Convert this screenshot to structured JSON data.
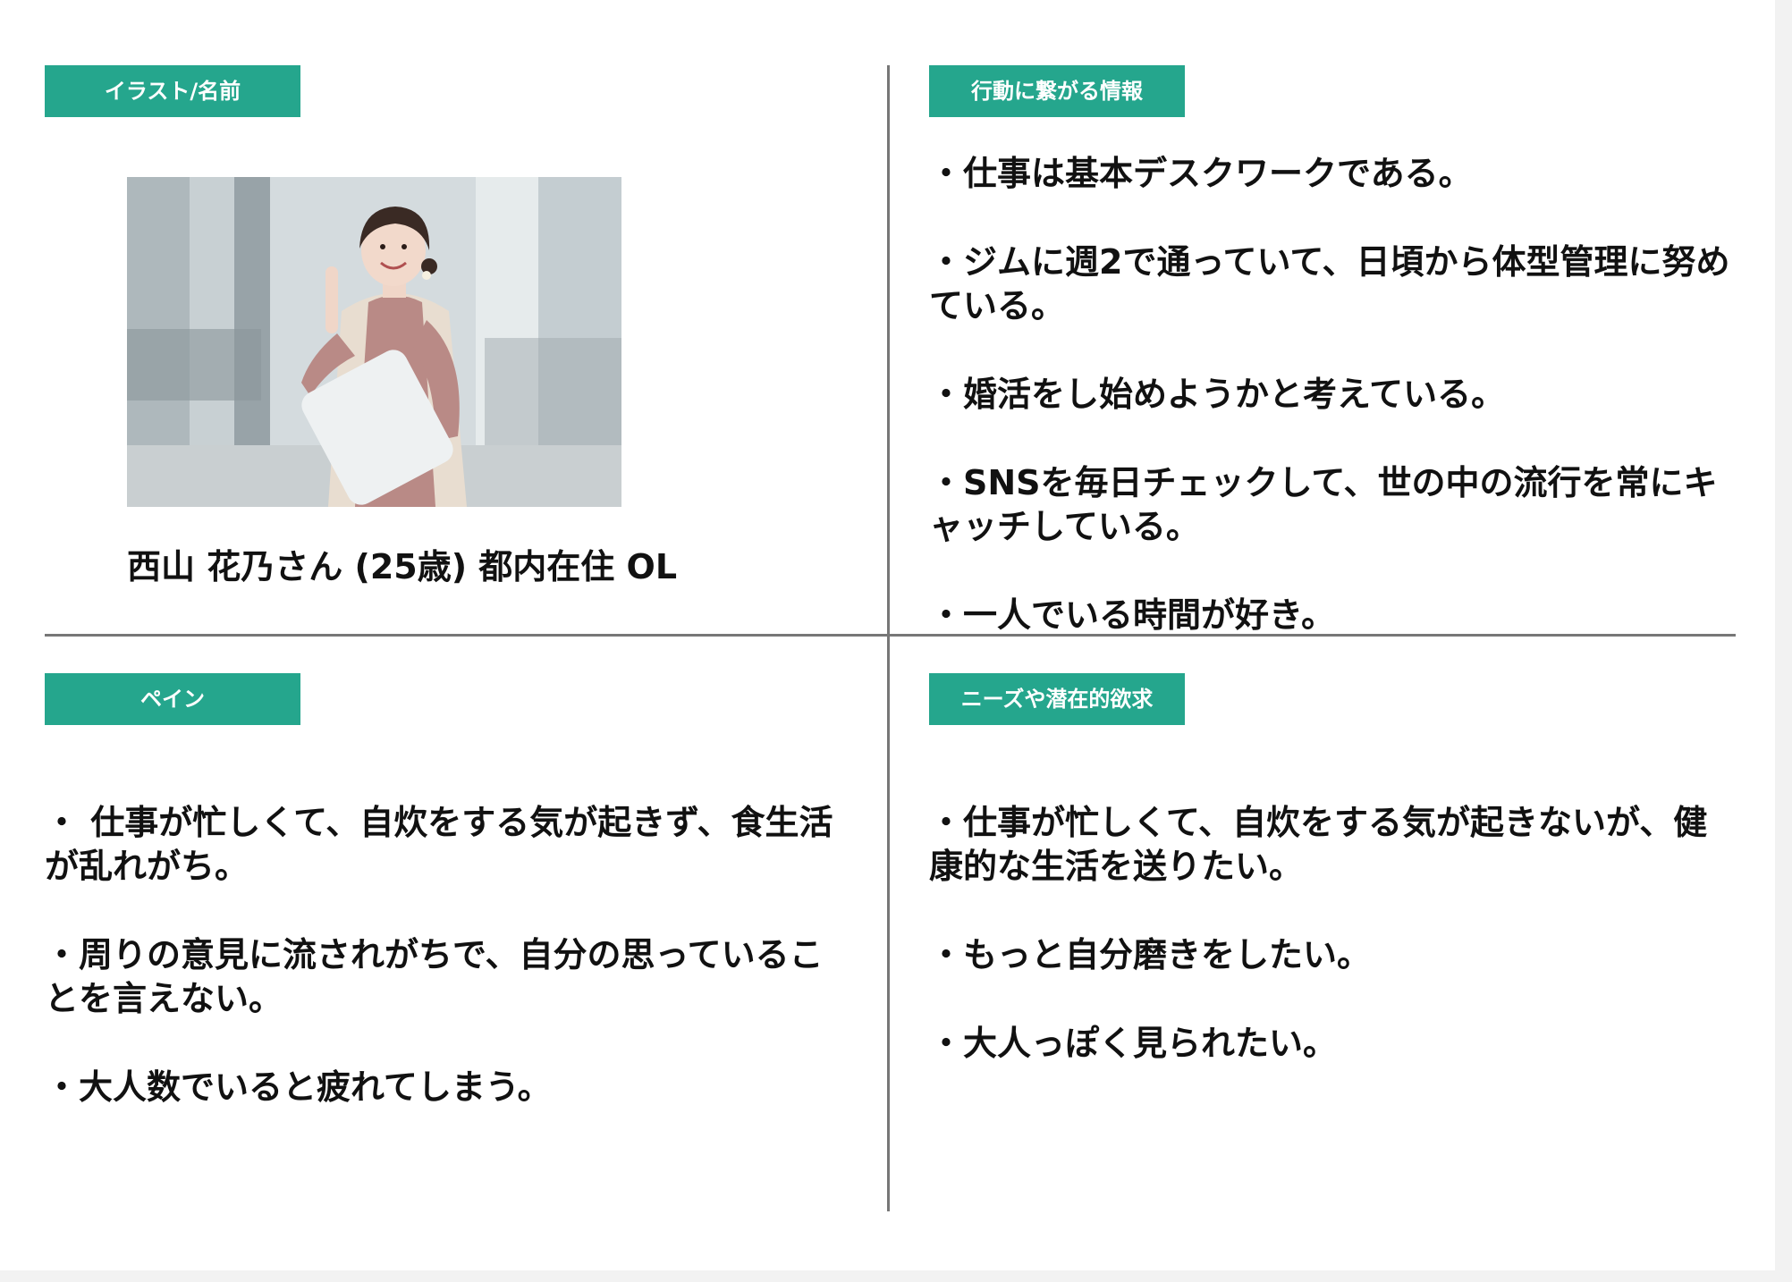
{
  "sections": {
    "profile": {
      "tag": "イラスト/名前",
      "persona_name": "西山 花乃さん (25歳) 都内在住 OL"
    },
    "behavior": {
      "tag": "行動に繋がる情報",
      "items": [
        "・仕事は基本デスクワークである。",
        "・ジムに週2で通っていて、日頃から体型管理に努めている。",
        "・婚活をし始めようかと考えている。",
        "・SNSを毎日チェックして、世の中の流行を常にキャッチしている。",
        "・一人でいる時間が好き。"
      ]
    },
    "pain": {
      "tag": "ペイン",
      "items": [
        "・ 仕事が忙しくて、自炊をする気が起きず、食生活が乱れがち。",
        "・周りの意見に流されがちで、自分の思っていることを言えない。",
        "・大人数でいると疲れてしまう。"
      ]
    },
    "needs": {
      "tag": "ニーズや潜在的欲求",
      "items": [
        "・仕事が忙しくて、自炊をする気が起きないが、健康的な生活を送りたい。",
        "・もっと自分磨きをしたい。",
        "・大人っぽく見られたい。"
      ]
    }
  },
  "colors": {
    "tag_bg": "#25a68d",
    "divider": "#777777",
    "text": "#111111"
  }
}
